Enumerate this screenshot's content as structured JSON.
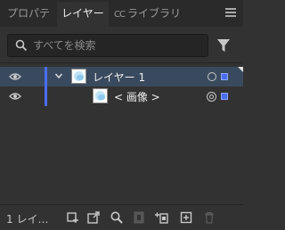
{
  "tabs": [
    {
      "label": "プロパティ"
    },
    {
      "label": "レイヤー"
    },
    {
      "label": "ライブラリ",
      "prefix": "CC"
    }
  ],
  "search": {
    "placeholder": "すべてを検索",
    "value": ""
  },
  "layers": [
    {
      "name": "レイヤー 1",
      "expanded": true,
      "color": "#4a6df0"
    },
    {
      "name": "< 画像 >",
      "color": "#4a6df0"
    }
  ],
  "footer": {
    "layer_count": "1 レイ…"
  },
  "colors": {
    "selection": "#3a4a5e",
    "layer_color": "#4a6df0"
  },
  "icons": [
    "panel-menu-icon",
    "search-icon",
    "filter-icon",
    "eye-icon",
    "chevron-down-icon",
    "target-circle-icon",
    "selection-square-icon",
    "collect-for-export-icon",
    "export-icon",
    "locate-object-icon",
    "clipping-mask-icon",
    "new-sublayer-icon",
    "new-layer-icon",
    "trash-icon"
  ]
}
